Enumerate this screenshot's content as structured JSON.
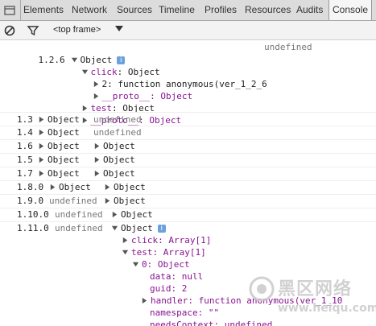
{
  "tabs": [
    "Elements",
    "Network",
    "Sources",
    "Timeline",
    "Profiles",
    "Resources",
    "Audits",
    "Console"
  ],
  "toolbar": {
    "frame": "<top frame>"
  },
  "log": {
    "r126": {
      "ver": "1.2.6",
      "obj": "Object",
      "val": "undefined"
    },
    "click": {
      "key": "click",
      "obj": "Object"
    },
    "fn": {
      "text": "2: function anonymous(ver_1_2_6"
    },
    "proto1": {
      "text": "__proto__: Object"
    },
    "test": {
      "key": "test",
      "obj": "Object"
    },
    "proto2": {
      "text": "__proto__: Object"
    },
    "r13": {
      "ver": "1.3",
      "a": "Object",
      "b": "undefined"
    },
    "r14": {
      "ver": "1.4",
      "a": "Object",
      "b": "undefined"
    },
    "r16": {
      "ver": "1.6",
      "a": "Object",
      "b": "Object"
    },
    "r15": {
      "ver": "1.5",
      "a": "Object",
      "b": "Object"
    },
    "r17": {
      "ver": "1.7",
      "a": "Object",
      "b": "Object"
    },
    "r180": {
      "ver": "1.8.0",
      "a": "Object",
      "b": "Object"
    },
    "r190": {
      "ver": "1.9.0",
      "a": "undefined",
      "b": "Object"
    },
    "r1100": {
      "ver": "1.10.0",
      "a": "undefined",
      "b": "Object"
    },
    "r1110": {
      "ver": "1.11.0",
      "a": "undefined",
      "b": "Object"
    },
    "sub": {
      "click": "click: Array[1]",
      "test": "test: Array[1]",
      "zero": "0: Object",
      "data": "data: null",
      "guid": "guid: 2",
      "handler": "handler: function anonymous(ver_1_10",
      "namespace": "namespace: \"\"",
      "needs": "needsContext: undefined"
    }
  },
  "watermark": {
    "text": "黑区网络",
    "url": "www.heiqu.com"
  }
}
